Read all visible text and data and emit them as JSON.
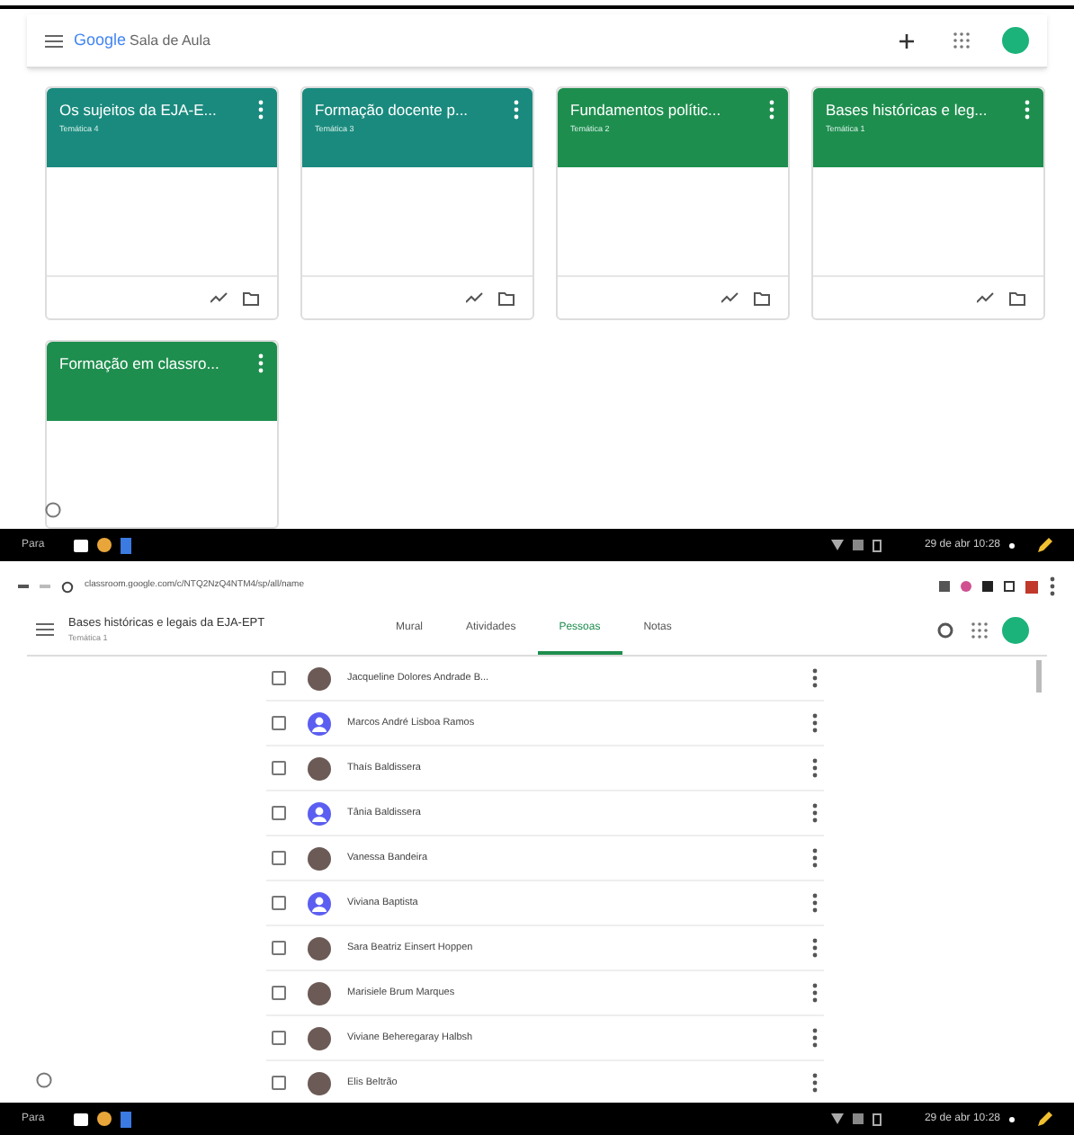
{
  "top_window": {
    "app_bar": {
      "brand": "Google",
      "product": "Sala de Aula"
    },
    "cards": [
      {
        "title": "Os sujeitos da EJA-E...",
        "subtitle": "Temática 4",
        "color": "#1a8a7e"
      },
      {
        "title": "Formação docente p...",
        "subtitle": "Temática 3",
        "color": "#1a8a7e"
      },
      {
        "title": "Fundamentos polític...",
        "subtitle": "Temática 2",
        "color": "#1e8e4e"
      },
      {
        "title": "Bases históricas e leg...",
        "subtitle": "Temática 1",
        "color": "#1e8e4e"
      },
      {
        "title": "Formação em classro...",
        "color": "#1e8e4e"
      }
    ],
    "taskbar": {
      "launcher": "Para",
      "clock": "29 de abr 10:28"
    }
  },
  "bottom_window": {
    "browser": {
      "url": "classroom.google.com/c/NTQ2NzQ4NTM4/sp/all/name"
    },
    "class": {
      "title": "Bases históricas e legais da EJA-EPT",
      "subtitle": "Temática 1"
    },
    "tabs": [
      {
        "label": "Mural",
        "selected": false
      },
      {
        "label": "Atividades",
        "selected": false
      },
      {
        "label": "Pessoas",
        "selected": true
      },
      {
        "label": "Notas",
        "selected": false
      }
    ],
    "students": [
      {
        "name": "Jacqueline Dolores Andrade B...",
        "kind": "photo",
        "checked": false
      },
      {
        "name": "Marcos André Lisboa Ramos",
        "kind": "default",
        "checked": false
      },
      {
        "name": "Thaís Baldissera",
        "kind": "photo",
        "checked": false
      },
      {
        "name": "Tânia Baldissera",
        "kind": "default",
        "checked": false
      },
      {
        "name": "Vanessa Bandeira",
        "kind": "photo",
        "checked": false
      },
      {
        "name": "Viviana Baptista",
        "kind": "default",
        "checked": false
      },
      {
        "name": "Sara Beatriz Einsert Hoppen",
        "kind": "photo",
        "checked": false
      },
      {
        "name": "Marisiele Brum Marques",
        "kind": "photo",
        "checked": false
      },
      {
        "name": "Viviane Beheregaray Halbsh",
        "kind": "photo",
        "checked": false
      },
      {
        "name": "Elis Beltrão",
        "kind": "photo",
        "checked": false
      }
    ],
    "taskbar": {
      "launcher": "Para",
      "clock": "29 de abr 10:28"
    }
  }
}
